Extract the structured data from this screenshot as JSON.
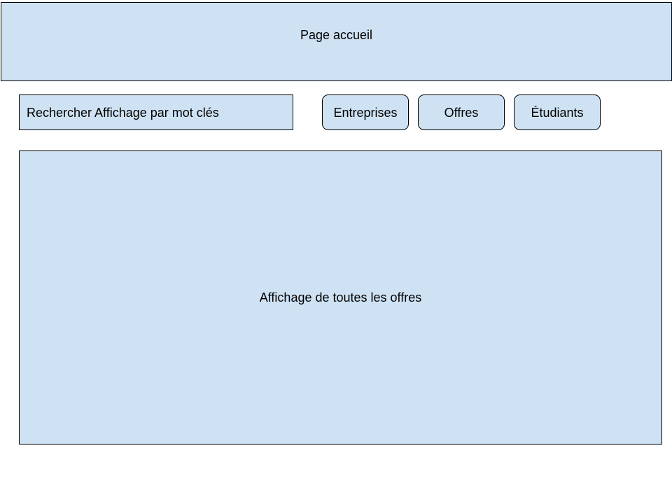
{
  "header": {
    "title": "Page accueil"
  },
  "search": {
    "label": "Rechercher Affichage par mot clés"
  },
  "nav": {
    "items": [
      {
        "label": "Entreprises"
      },
      {
        "label": "Offres"
      },
      {
        "label": "Étudiants"
      }
    ]
  },
  "main": {
    "label": "Affichage de toutes les offres"
  },
  "colors": {
    "fill": "#cfe2f3",
    "border": "#000000",
    "background": "#ffffff"
  }
}
